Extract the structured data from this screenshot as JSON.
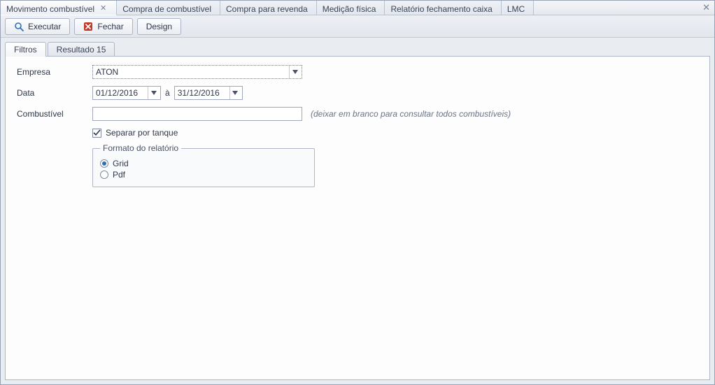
{
  "doc_tabs": {
    "items": [
      {
        "label": "Movimento combustível",
        "closable": true
      },
      {
        "label": "Compra de combustível"
      },
      {
        "label": "Compra para revenda"
      },
      {
        "label": "Medição física"
      },
      {
        "label": "Relatório fechamento caixa"
      },
      {
        "label": "LMC"
      }
    ],
    "active_index": 0
  },
  "toolbar": {
    "execute_label": "Executar",
    "close_label": "Fechar",
    "design_label": "Design"
  },
  "inner_tabs": {
    "filters_label": "Filtros",
    "result_label": "Resultado 15",
    "active": "filters"
  },
  "form": {
    "empresa_label": "Empresa",
    "empresa_value": "ATON",
    "data_label": "Data",
    "data_from": "01/12/2016",
    "data_sep": "à",
    "data_to": "31/12/2016",
    "combustivel_label": "Combustível",
    "combustivel_value": "",
    "combustivel_hint": "(deixar em branco para consultar todos combustíveis)",
    "separar_tanque_label": "Separar por tanque",
    "separar_tanque_checked": true,
    "formato_legend": "Formato do relatório",
    "formato_grid_label": "Grid",
    "formato_pdf_label": "Pdf",
    "formato_selected": "grid"
  }
}
